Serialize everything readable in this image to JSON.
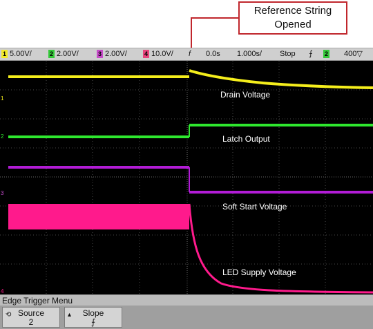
{
  "callout": {
    "line1": "Reference String",
    "line2": "Opened"
  },
  "status_bar": {
    "channels": [
      {
        "num": "1",
        "scale": "5.00V/",
        "color": "#f2ea2a"
      },
      {
        "num": "2",
        "scale": "2.00V/",
        "color": "#35c93a"
      },
      {
        "num": "3",
        "scale": "2.00V/",
        "color": "#c64cc8"
      },
      {
        "num": "4",
        "scale": "10.0V/",
        "color": "#e8447d"
      }
    ],
    "time_offset": "0.0s",
    "timebase": "1.000s/",
    "run_state": "Stop",
    "trigger_slope_symbol": "⨍",
    "trigger_source": "2",
    "trigger_level": "400",
    "trigger_level_suffix": "▽",
    "trigger_marker": "f"
  },
  "traces": {
    "drain_voltage": "Drain Voltage",
    "latch_output": "Latch Output",
    "soft_start_voltage": "Soft Start Voltage",
    "led_supply_voltage": "LED Supply Voltage"
  },
  "colors": {
    "yellow": "#f5ee1c",
    "green": "#2ee82e",
    "purple": "#b21cd6",
    "pink": "#ff1a8c",
    "grid": "#3a3a3a"
  },
  "menu": {
    "title": "Edge Trigger Menu",
    "softkeys": [
      {
        "icon": "rotate-knob-icon",
        "label": "Source",
        "value": "2"
      },
      {
        "icon": "arrow-up-icon",
        "label": "Slope",
        "value": "⨍"
      }
    ]
  }
}
